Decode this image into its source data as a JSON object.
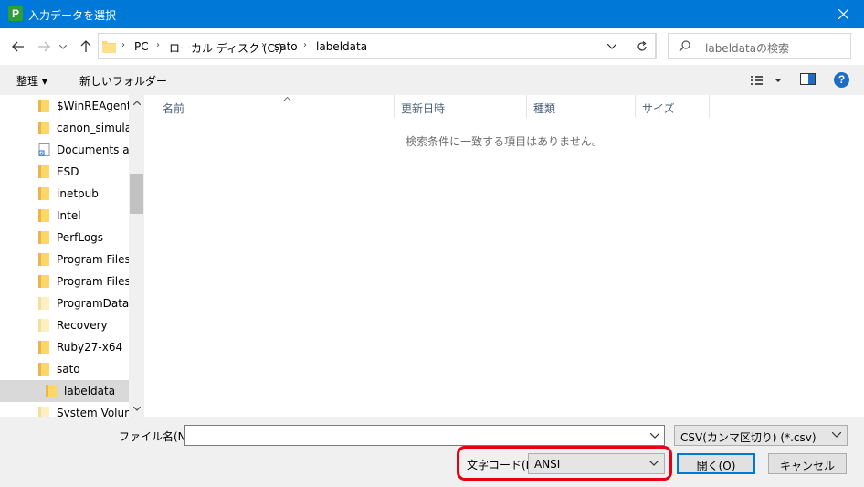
{
  "window": {
    "title": "入力データを選択",
    "app_icon_letter": "P"
  },
  "address": {
    "crumbs": [
      "PC",
      "ローカル ディスク (C:)",
      "sato",
      "labeldata"
    ],
    "search_placeholder": "labeldataの検索"
  },
  "toolbar": {
    "organize": "整理 ▾",
    "new_folder": "新しいフォルダー"
  },
  "tree": [
    {
      "label": "$WinREAgent",
      "type": "folder"
    },
    {
      "label": "canon_simulate",
      "type": "folder"
    },
    {
      "label": "Documents and",
      "type": "shortcut"
    },
    {
      "label": "ESD",
      "type": "folder"
    },
    {
      "label": "inetpub",
      "type": "folder"
    },
    {
      "label": "Intel",
      "type": "folder"
    },
    {
      "label": "PerfLogs",
      "type": "folder"
    },
    {
      "label": "Program Files",
      "type": "folder"
    },
    {
      "label": "Program Files (",
      "type": "folder"
    },
    {
      "label": "ProgramData",
      "type": "folder-light"
    },
    {
      "label": "Recovery",
      "type": "folder-light"
    },
    {
      "label": "Ruby27-x64",
      "type": "folder"
    },
    {
      "label": "sato",
      "type": "folder"
    },
    {
      "label": "labeldata",
      "type": "folder",
      "selected": true
    },
    {
      "label": "System Volume",
      "type": "folder-light"
    }
  ],
  "columns": [
    "名前",
    "更新日時",
    "種類",
    "サイズ"
  ],
  "empty_message": "検索条件に一致する項目はありません。",
  "bottom": {
    "filename_label": "ファイル名(N):",
    "filename_value": "",
    "filetype_value": "CSV(カンマ区切り) (*.csv)",
    "encoding_label": "文字コード(E)",
    "encoding_value": "ANSI",
    "open_label": "開く(O)",
    "cancel_label": "キャンセル"
  },
  "colors": {
    "titlebar": "#0078d7",
    "highlight": "#e60012",
    "folder": "#ffd766"
  }
}
